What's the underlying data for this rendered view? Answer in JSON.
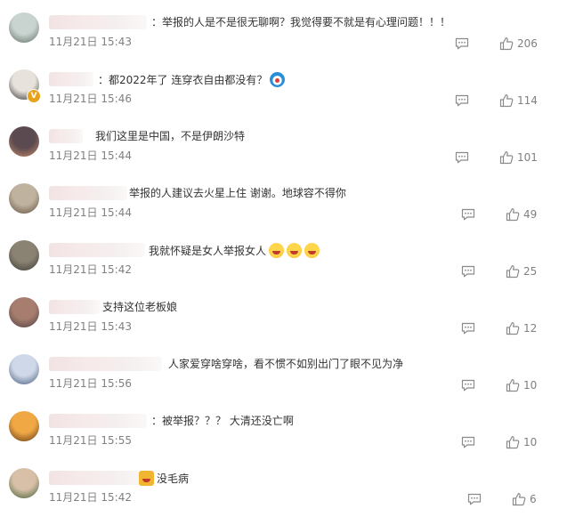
{
  "comments": [
    {
      "text": "：举报的人是不是很无聊啊？我觉得要不就是有心理问题！！！",
      "date": "11月21日",
      "time": "15:43",
      "likes": "206"
    },
    {
      "text": "：都2022年了 连穿衣自由都没有？",
      "date": "11月21日",
      "time": "15:46",
      "likes": "114",
      "emoji": [
        "doraemon-emoji"
      ]
    },
    {
      "text": "我们这里是中国，不是伊朗沙特",
      "date": "11月21日",
      "time": "15:44",
      "likes": "101"
    },
    {
      "text": "举报的人建议去火星上住 谢谢。地球容不得你",
      "date": "11月21日",
      "time": "15:44",
      "likes": "49"
    },
    {
      "text": "我就怀疑是女人举报女人",
      "date": "11月21日",
      "time": "15:42",
      "likes": "25",
      "emoji": [
        "laughing-tears-emoji",
        "grinning-emoji",
        "laughing-emoji"
      ]
    },
    {
      "text": "支持这位老板娘",
      "date": "11月21日",
      "time": "15:43",
      "likes": "12"
    },
    {
      "text": "人家爱穿啥穿啥，看不惯不如别出门了眼不见为净",
      "date": "11月21日",
      "time": "15:56",
      "likes": "10"
    },
    {
      "text": "：被举报？？？ 大清还没亡啊",
      "date": "11月21日",
      "time": "15:55",
      "likes": "10"
    },
    {
      "text": "没毛病",
      "date": "11月21日",
      "time": "15:42",
      "likes": "6",
      "emoji": [
        "medal-emoji"
      ]
    }
  ],
  "icons": {
    "reply": "comment-reply-icon",
    "like": "thumbs-up-icon"
  },
  "colors": {
    "meta": "#808080",
    "text": "#333333",
    "icon": "#8a8a8a"
  }
}
